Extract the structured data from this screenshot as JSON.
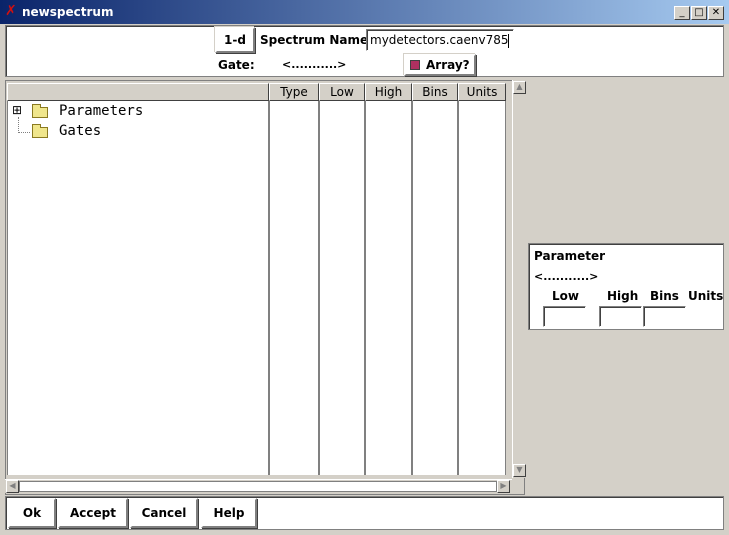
{
  "window": {
    "title": "newspectrum",
    "controls": [
      "_",
      "□",
      "✕"
    ]
  },
  "header": {
    "type_button": "1-d",
    "spectrum_name_label": "Spectrum Name:",
    "spectrum_name_value": "mydetectors.caenv785",
    "gate_label": "Gate:",
    "gate_value": "<...........>",
    "array_label": "Array?",
    "array_checked": true
  },
  "tree": {
    "columns": [
      "",
      "Type",
      "Low",
      "High",
      "Bins",
      "Units"
    ],
    "items": [
      {
        "label": "Parameters",
        "expander": "⊞"
      },
      {
        "label": "Gates",
        "expander": ""
      }
    ]
  },
  "parameter_panel": {
    "title": "Parameter",
    "value": "<...........>",
    "headers": [
      "Low",
      "High",
      "Bins",
      "Units"
    ],
    "low": "",
    "high": "",
    "bins": ""
  },
  "buttons": {
    "ok": "Ok",
    "accept": "Accept",
    "cancel": "Cancel",
    "help": "Help"
  },
  "colors": {
    "titlebar_start": "#0a246a",
    "titlebar_end": "#a6caf0",
    "checkbox": "#b03060",
    "folder": "#f0e68c"
  }
}
